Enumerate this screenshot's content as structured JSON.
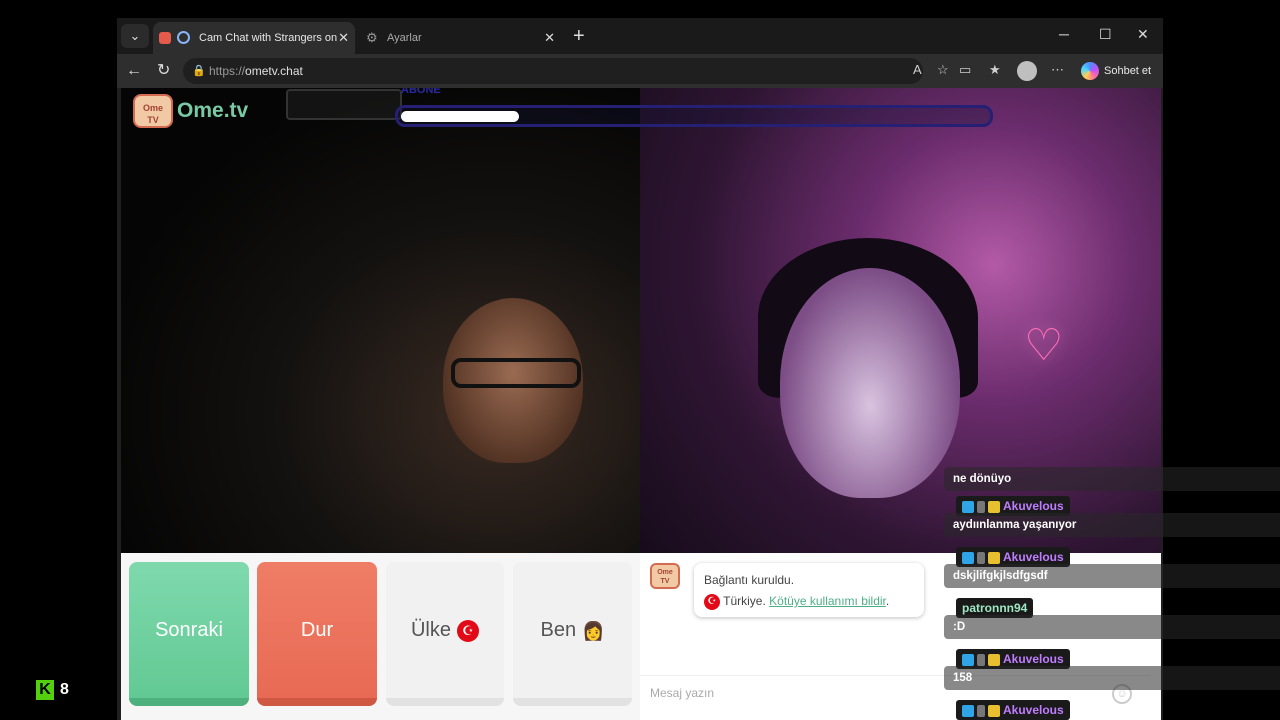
{
  "browser": {
    "tabs": [
      {
        "label": "Cam Chat with Strangers on O",
        "active": true
      },
      {
        "label": "Ayarlar",
        "active": false
      }
    ],
    "url_protocol": "https://",
    "url_host": "ometv.chat",
    "copilot_label": "Sohbet et"
  },
  "site": {
    "logo_tv": "Ome TV",
    "logo_name_a": "Ome",
    "logo_name_b": ".tv",
    "overlay_label": "ABONE",
    "overlay_progress": 0.2
  },
  "controls": {
    "next_label": "Sonraki",
    "stop_label": "Dur",
    "country_label": "Ülke",
    "me_label": "Ben",
    "me_emoji": "👩"
  },
  "chat": {
    "connected_text": "Bağlantı kuruldu.",
    "country_text": "Türkiye.",
    "report_link": "Kötüye kullanımı bildir",
    "input_placeholder": "Mesaj yazın"
  },
  "stream_chat": {
    "messages": [
      {
        "user": "",
        "text": "ne dönüyo"
      },
      {
        "user": "Akuvelous",
        "text": "aydıınlanma yaşanıyor"
      },
      {
        "user": "Akuvelous",
        "text": "dskjlifgkjlsdfgsdf"
      },
      {
        "user": "patronnn94",
        "text": ":D"
      },
      {
        "user": "Akuvelous",
        "text": "158"
      },
      {
        "user": "Akuvelous",
        "text": ""
      }
    ]
  },
  "overlay_counter": "8",
  "colors": {
    "next": "#6fd3a2",
    "stop": "#eb735d",
    "accent_link": "#4fae85",
    "username_purple": "#c07cff"
  }
}
